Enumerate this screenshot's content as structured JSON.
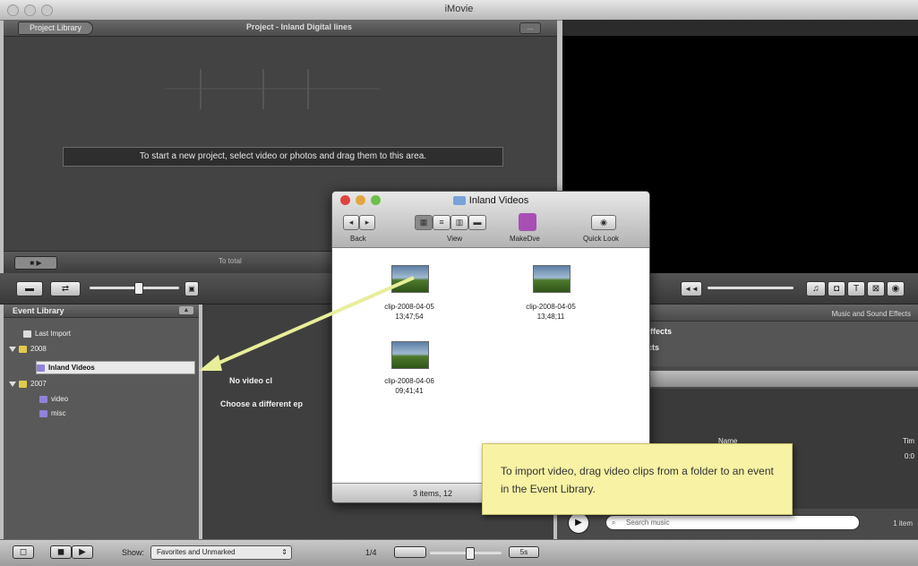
{
  "window": {
    "title": "iMovie"
  },
  "project": {
    "library_button": "Project Library",
    "title": "Project - Inland Digital lines",
    "dots": "...",
    "hint": "To start a new project, select video or photos and drag them to this area.",
    "footer_total": "To total"
  },
  "event_library": {
    "title": "Event Library",
    "items": [
      {
        "label": "Last Import"
      },
      {
        "label": "2008"
      },
      {
        "label": "Inland Videos"
      },
      {
        "label": "2007"
      },
      {
        "label": "video"
      },
      {
        "label": "misc"
      }
    ]
  },
  "event_browser": {
    "no_video": "No video cl",
    "choose_diff": "Choose a different ep"
  },
  "music": {
    "title": "Music and Sound Effects",
    "items": [
      "d Effects",
      "ffects"
    ],
    "col_name": "Name",
    "col_time": "Tim",
    "time_value": "0:0",
    "search_placeholder": "Search music",
    "count": "1 item"
  },
  "finder": {
    "title": "Inland Videos",
    "toolbar": {
      "back": "Back",
      "view": "View",
      "makedve": "MakeDve",
      "quicklook": "Quick Look"
    },
    "files": [
      {
        "name": "clip-2008-04-05",
        "time": "13;47;54"
      },
      {
        "name": "clip-2008-04-05",
        "time": "13;48;11"
      },
      {
        "name": "clip-2008-04-06",
        "time": "09;41;41"
      }
    ],
    "status": "3 items, 12"
  },
  "bottom": {
    "show_label": "Show:",
    "show_value": "Favorites and Unmarked",
    "zoom_label": "1/4",
    "zoom_value": "5s"
  },
  "callout": {
    "text": "To import video, drag video clips from a folder to an event in the Event Library."
  },
  "colors": {
    "callout_bg": "#f7f2a4",
    "arrow": "#e8ee9a",
    "selection": "#e9e9e9"
  }
}
